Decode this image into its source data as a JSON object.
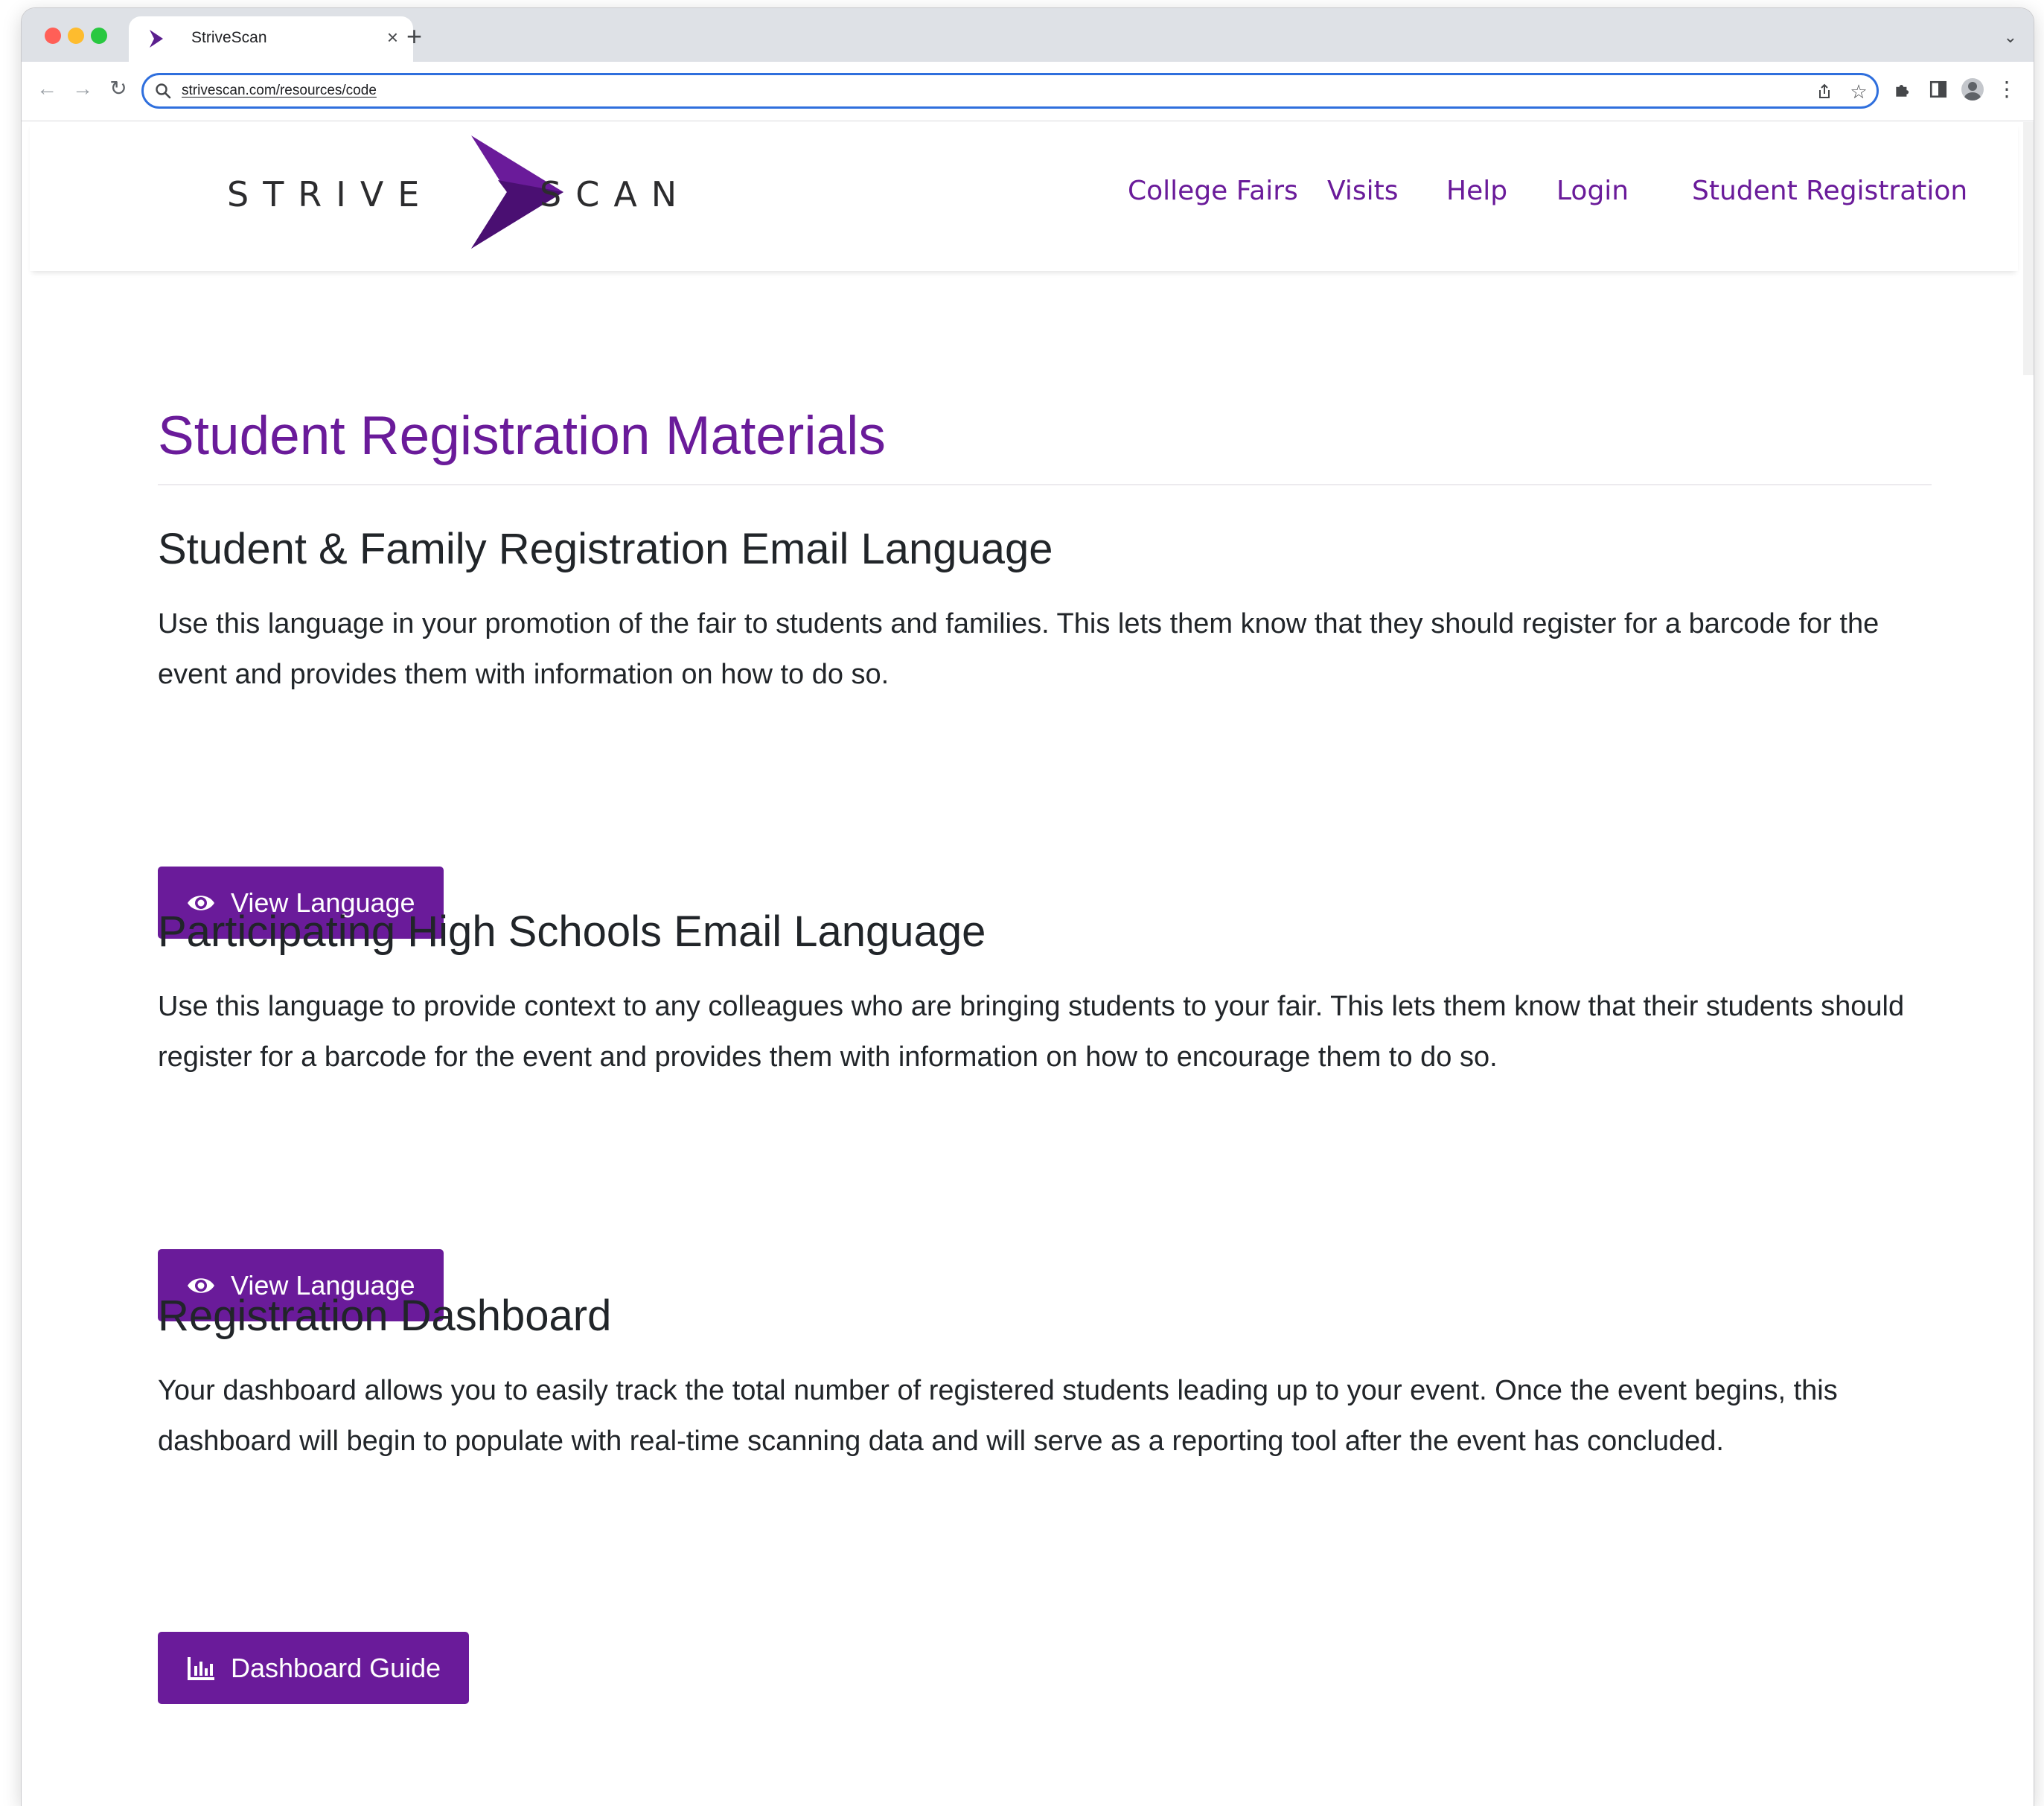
{
  "browser": {
    "tab": {
      "title": "StriveScan",
      "close_glyph": "×",
      "favicon": "strivescan-chevron-icon"
    },
    "new_tab_glyph": "+",
    "tab_menu_glyph": "⌄",
    "nav": {
      "back_glyph": "←",
      "forward_glyph": "→",
      "reload_glyph": "↻"
    },
    "address_bar": {
      "url": "strivescan.com/resources/code"
    },
    "toolbar_icons": [
      "share-icon",
      "bookmark-star-icon",
      "extensions-puzzle-icon",
      "side-panel-icon",
      "profile-avatar-icon",
      "more-menu-icon"
    ]
  },
  "site": {
    "logo": {
      "left_word": "STRIVE",
      "right_word": "SCAN"
    },
    "nav": {
      "college_fairs": "College Fairs",
      "visits": "Visits",
      "help": "Help",
      "login": "Login",
      "student_registration": "Student Registration"
    },
    "page_title": "Student Registration Materials",
    "sections": [
      {
        "heading": "Student & Family Registration Email Language",
        "body": "Use this language in your promotion of the fair to students and families. This lets them know that they should register for a barcode for the event and provides them with information on how to do so.",
        "button_label": "View Language",
        "button_icon": "eye-icon"
      },
      {
        "heading": "Participating High Schools Email Language",
        "body": "Use this language to provide context to any colleagues who are bringing students to your fair. This lets them know that their students should register for a barcode for the event and provides them with information on how to encourage them to do so.",
        "button_label": "View Language",
        "button_icon": "eye-icon"
      },
      {
        "heading": "Registration Dashboard",
        "body": "Your dashboard allows you to easily track the total number of registered students leading up to your event. Once the event begins, this dashboard will begin to populate with real-time scanning data and will serve as a reporting tool after the event has concluded.",
        "button_label": "Dashboard Guide",
        "button_icon": "bar-chart-icon"
      }
    ],
    "colors": {
      "brand_purple": "#6a1b9a",
      "text": "#212529",
      "omnibox_focus": "#2f6fdd"
    }
  }
}
